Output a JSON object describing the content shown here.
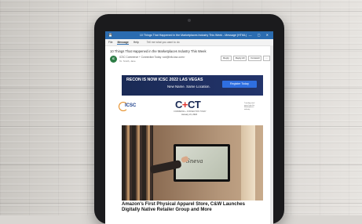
{
  "window": {
    "title": "10 Things That Happened in the Marketplaces Industry This Week - Message (HTML)",
    "controls": "— ▢ ✕"
  },
  "ribbon": {
    "tabs": [
      "File",
      "Message",
      "Help"
    ],
    "tell_me": "Tell me what you want to do"
  },
  "email": {
    "subject": "10 Things That Happened in the Marketplaces Industry This Week",
    "avatar_initials": "IC",
    "sender": "ICSC Commerce + Connection Today <cct@info.icsc.com>",
    "to": "To: Smith, Jane",
    "actions": [
      "Reply",
      "Reply All",
      "Forward",
      "..."
    ]
  },
  "banner": {
    "line1": "RECON IS NOW ICSC 2022 LAS VEGAS",
    "line2": "New Name. Same Location.",
    "button": "Register Today"
  },
  "newsletter": {
    "org_logo": "ICSC",
    "brand_left": "C",
    "brand_plus": "+",
    "brand_right": "CT",
    "brand_sub": "COMMERCE + CONNECTION TODAY",
    "date": "January 21, 2022",
    "side_note": "Trending retail news from the Marketplaces industry"
  },
  "photo": {
    "screen_word": "Sneva"
  },
  "article": {
    "headline": "Amazon's First Physical Apparel Store, C&W Launches Digitally Native Retailer Group and More"
  }
}
